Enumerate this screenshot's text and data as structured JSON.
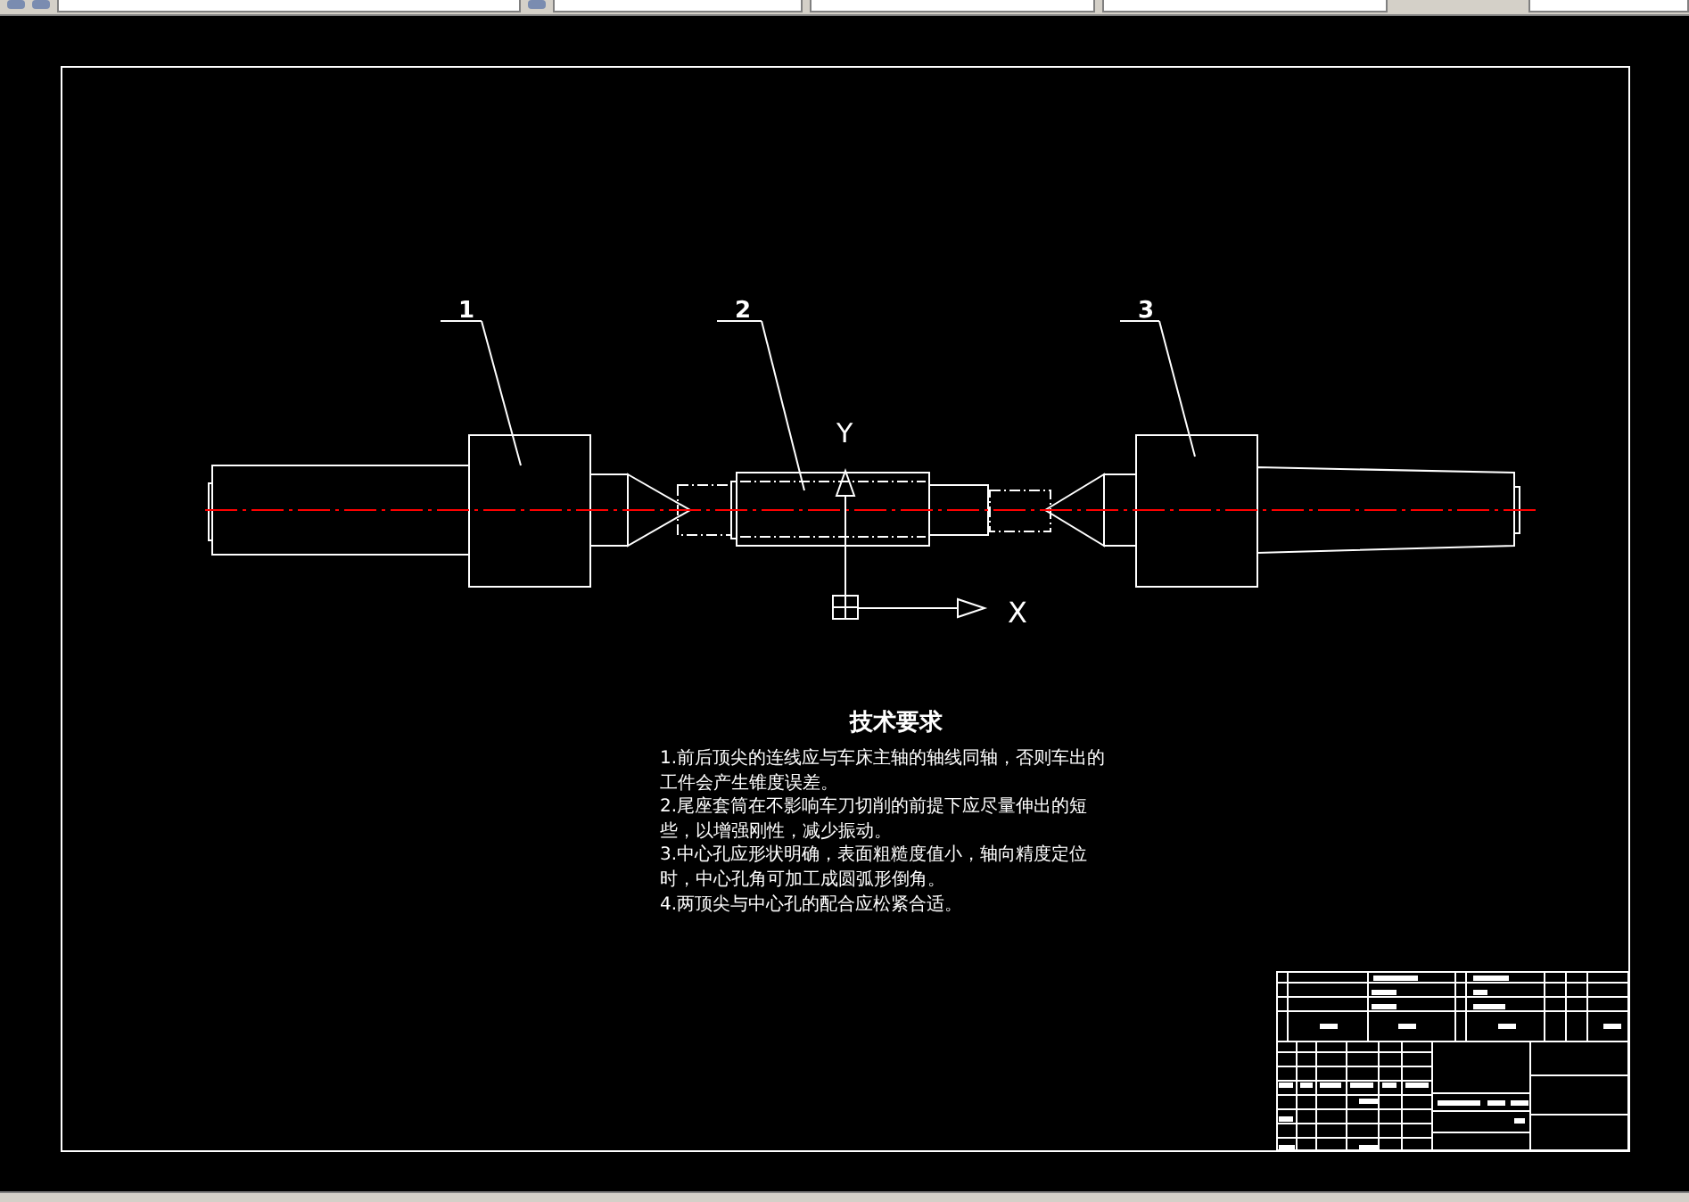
{
  "drawing": {
    "part_labels": [
      "1",
      "2",
      "3"
    ],
    "axis_labels": {
      "y": "Y",
      "x": "X"
    }
  },
  "notes": {
    "title": "技术要求",
    "lines": [
      "1.前后顶尖的连线应与车床主轴的轴线同轴，否则车出的",
      "工件会产生锥度误差。",
      "2.尾座套筒在不影响车刀切削的前提下应尽量伸出的短",
      "些，以增强刚性，减少振动。",
      "3.中心孔应形状明确，表面粗糙度值小，轴向精度定位",
      "时，中心孔角可加工成圆弧形倒角。",
      "4.两顶尖与中心孔的配合应松紧合适。"
    ]
  }
}
